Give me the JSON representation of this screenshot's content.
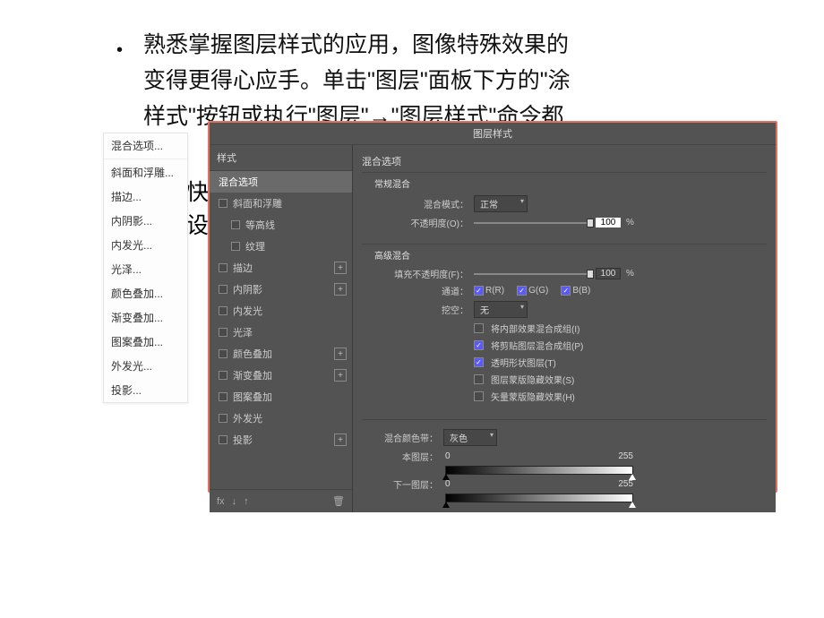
{
  "bg": {
    "line1": "熟悉掌握图层样式的应用，图像特殊效果的",
    "line2": "变得更得心应手。单击\"图层\"面板下方的\"涂",
    "line3": "样式\"按钮或执行\"图层\"→\"图层样式\"命令都",
    "occl1": "快",
    "occl2": "设"
  },
  "ctx": {
    "items": [
      "混合选项...",
      "斜面和浮雕...",
      "描边...",
      "内阴影...",
      "内发光...",
      "光泽...",
      "颜色叠加...",
      "渐变叠加...",
      "图案叠加...",
      "外发光...",
      "投影..."
    ]
  },
  "dialog": {
    "title": "图层样式",
    "styles_header": "样式",
    "styles": [
      {
        "label": "混合选项",
        "selected": true
      },
      {
        "label": "斜面和浮雕",
        "checkbox": true
      },
      {
        "label": "等高线",
        "checkbox": true,
        "indent": true
      },
      {
        "label": "纹理",
        "checkbox": true,
        "indent": true
      },
      {
        "label": "描边",
        "checkbox": true,
        "plus": true
      },
      {
        "label": "内阴影",
        "checkbox": true,
        "plus": true
      },
      {
        "label": "内发光",
        "checkbox": true
      },
      {
        "label": "光泽",
        "checkbox": true
      },
      {
        "label": "颜色叠加",
        "checkbox": true,
        "plus": true
      },
      {
        "label": "渐变叠加",
        "checkbox": true,
        "plus": true
      },
      {
        "label": "图案叠加",
        "checkbox": true
      },
      {
        "label": "外发光",
        "checkbox": true
      },
      {
        "label": "投影",
        "checkbox": true,
        "plus": true
      }
    ],
    "footer": {
      "fx": "fx",
      "down": "↓",
      "up": "↑",
      "trash": "🗑"
    },
    "opts": {
      "heading": "混合选项",
      "general": {
        "title": "常规混合",
        "mode_label": "混合模式：",
        "mode_value": "正常",
        "opacity_label": "不透明度(O)：",
        "opacity_value": "100",
        "pct": "%"
      },
      "advanced": {
        "title": "高级混合",
        "fill_label": "填充不透明度(F)：",
        "fill_value": "100",
        "pct": "%",
        "channels_label": "通道：",
        "r": "R(R)",
        "g": "G(G)",
        "b": "B(B)",
        "knockout_label": "挖空：",
        "knockout_value": "无",
        "opts": [
          {
            "label": "将内部效果混合成组(I)",
            "on": false
          },
          {
            "label": "将剪贴图层混合成组(P)",
            "on": true
          },
          {
            "label": "透明形状图层(T)",
            "on": true
          },
          {
            "label": "图层蒙版隐藏效果(S)",
            "on": false
          },
          {
            "label": "矢量蒙版隐藏效果(H)",
            "on": false
          }
        ]
      },
      "blendif": {
        "label": "混合颜色带：",
        "value": "灰色",
        "this_label": "本图层：",
        "this_lo": "0",
        "this_hi": "255",
        "under_label": "下一图层：",
        "under_lo": "0",
        "under_hi": "255"
      }
    }
  }
}
